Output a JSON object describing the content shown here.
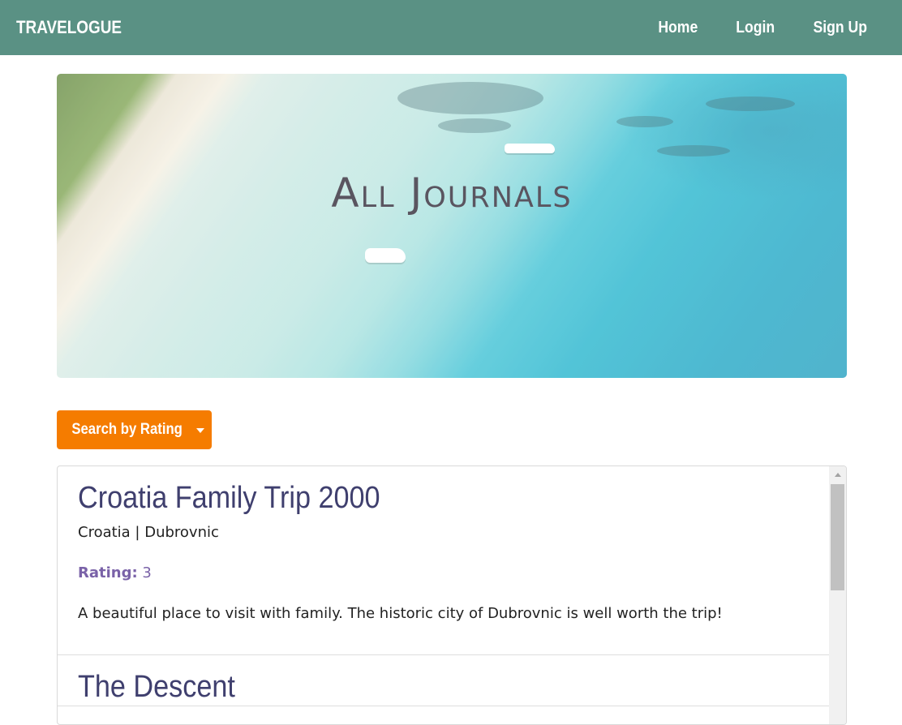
{
  "navbar": {
    "brand": "TRAVELOGUE",
    "links": [
      {
        "label": "Home"
      },
      {
        "label": "Login"
      },
      {
        "label": "Sign Up"
      }
    ]
  },
  "hero": {
    "title": "All Journals"
  },
  "filter": {
    "button_label": "Search by Rating",
    "icon": "caret-down-icon"
  },
  "journals": [
    {
      "title": "Croatia Family Trip 2000",
      "location": "Croatia | Dubrovnic",
      "rating_label": "Rating:",
      "rating_value": "3",
      "description": "A beautiful place to visit with family. The historic city of Dubrovnic is well worth the trip!"
    },
    {
      "title": "The Descent"
    }
  ],
  "colors": {
    "navbar": "#5a9184",
    "button": "#f57c00",
    "title": "#3f3f6e",
    "rating": "#7a62a8"
  }
}
